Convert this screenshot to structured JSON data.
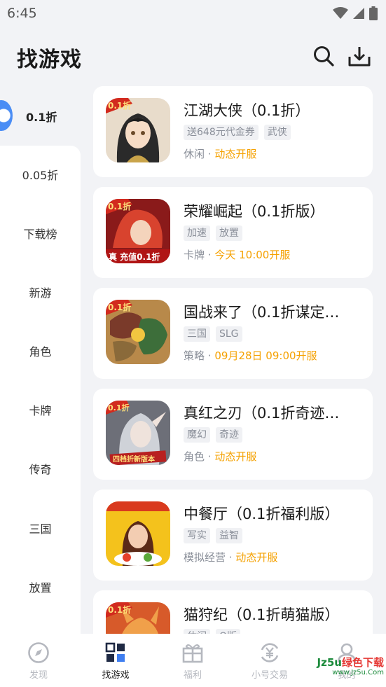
{
  "status_bar": {
    "time": "6:45",
    "icons": [
      "wifi-icon",
      "signal-icon",
      "battery-icon"
    ]
  },
  "header": {
    "title": "找游戏",
    "search_icon": "search-icon",
    "download_icon": "download-icon"
  },
  "sidebar": {
    "active": "0.1折",
    "items": [
      "0.05折",
      "下载榜",
      "新游",
      "角色",
      "卡牌",
      "传奇",
      "三国",
      "放置"
    ]
  },
  "games": [
    {
      "title": "江湖大侠（0.1折）",
      "tags": [
        "送648元代金券",
        "武侠"
      ],
      "category": "休闲",
      "open": "动态开服",
      "icon_badge": "0.1折"
    },
    {
      "title": "荣耀崛起（0.1折版）",
      "tags": [
        "加速",
        "放置"
      ],
      "category": "卡牌",
      "open": "今天 10:00开服",
      "icon_badge": "0.1折",
      "icon_banner": "真 充值0.1折"
    },
    {
      "title": "国战来了（0.1折谋定…",
      "tags": [
        "三国",
        "SLG"
      ],
      "category": "策略",
      "open": "09月28日 09:00开服",
      "icon_badge": "0.1折"
    },
    {
      "title": "真红之刃（0.1折奇迹…",
      "tags": [
        "魔幻",
        "奇迹"
      ],
      "category": "角色",
      "open": "动态开服",
      "icon_badge": "0.1折",
      "icon_banner": "四档折新版本"
    },
    {
      "title": "中餐厅（0.1折福利版）",
      "tags": [
        "写实",
        "益智"
      ],
      "category": "模拟经营",
      "open": "动态开服"
    },
    {
      "title": "猫狩纪（0.1折萌猫版）",
      "tags": [
        "休闲",
        "Q版"
      ],
      "category": "",
      "open": "",
      "icon_badge": "0.1折"
    }
  ],
  "separator": "·",
  "bottom_nav": [
    {
      "label": "发现",
      "icon": "compass-icon",
      "active": false
    },
    {
      "label": "找游戏",
      "icon": "grid-icon",
      "active": true
    },
    {
      "label": "福利",
      "icon": "gift-icon",
      "active": false
    },
    {
      "label": "小号交易",
      "icon": "exchange-icon",
      "active": false
    },
    {
      "label": "我的",
      "icon": "user-icon",
      "active": false
    }
  ],
  "watermark": {
    "main_a": "Jz5u",
    "main_b": "绿色下载",
    "sub": "www.Jz5u.Com"
  },
  "colors": {
    "accent_orange": "#f5a100",
    "active_blue": "#4a8df5",
    "tag_bg": "#f0f1f4"
  }
}
